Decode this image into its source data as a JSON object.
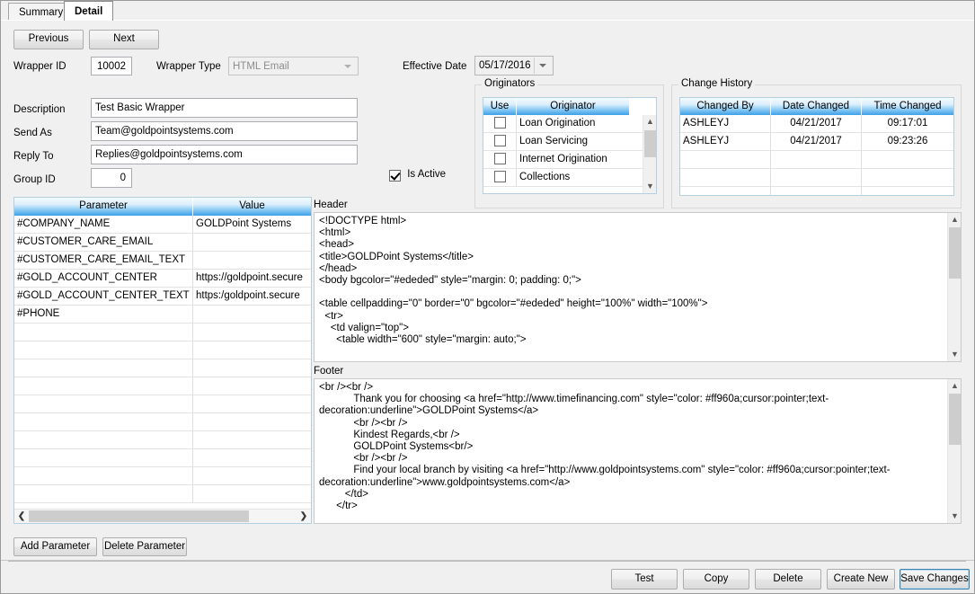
{
  "tabs": [
    {
      "label": "Summary",
      "active": false
    },
    {
      "label": "Detail",
      "active": true
    }
  ],
  "nav": {
    "previous_label": "Previous",
    "next_label": "Next"
  },
  "fields": {
    "wrapper_id_label": "Wrapper ID",
    "wrapper_id_value": "10002",
    "wrapper_type_label": "Wrapper Type",
    "wrapper_type_value": "HTML Email",
    "effective_date_label": "Effective Date",
    "effective_date_value": "05/17/2016",
    "description_label": "Description",
    "description_value": "Test Basic Wrapper",
    "send_as_label": "Send As",
    "send_as_value": "Team@goldpointsystems.com",
    "reply_to_label": "Reply To",
    "reply_to_value": "Replies@goldpointsystems.com",
    "group_id_label": "Group ID",
    "group_id_value": "0",
    "is_active_label": "Is Active",
    "is_active_checked": true
  },
  "originators": {
    "title": "Originators",
    "columns": [
      "Use",
      "Originator",
      ""
    ],
    "rows": [
      {
        "use": false,
        "name": "Loan Origination"
      },
      {
        "use": false,
        "name": "Loan Servicing"
      },
      {
        "use": false,
        "name": "Internet Origination"
      },
      {
        "use": false,
        "name": "Collections"
      }
    ]
  },
  "change_history": {
    "title": "Change History",
    "columns": [
      "Changed By",
      "Date Changed",
      "Time Changed"
    ],
    "rows": [
      {
        "changed_by": "ASHLEYJ",
        "date_changed": "04/21/2017",
        "time_changed": "09:17:01"
      },
      {
        "changed_by": "ASHLEYJ",
        "date_changed": "04/21/2017",
        "time_changed": "09:23:26"
      },
      {
        "changed_by": "",
        "date_changed": "",
        "time_changed": ""
      },
      {
        "changed_by": "",
        "date_changed": "",
        "time_changed": ""
      },
      {
        "changed_by": "",
        "date_changed": "",
        "time_changed": ""
      }
    ]
  },
  "parameters": {
    "columns": [
      "Parameter",
      "Value"
    ],
    "rows": [
      {
        "parameter": "#COMPANY_NAME",
        "value": "GOLDPoint Systems"
      },
      {
        "parameter": "#CUSTOMER_CARE_EMAIL",
        "value": ""
      },
      {
        "parameter": "#CUSTOMER_CARE_EMAIL_TEXT",
        "value": ""
      },
      {
        "parameter": "#GOLD_ACCOUNT_CENTER",
        "value": "https://goldpoint.secure"
      },
      {
        "parameter": "#GOLD_ACCOUNT_CENTER_TEXT",
        "value": "https:/goldpoint.secure"
      },
      {
        "parameter": "#PHONE",
        "value": ""
      },
      {
        "parameter": "",
        "value": ""
      },
      {
        "parameter": "",
        "value": ""
      },
      {
        "parameter": "",
        "value": ""
      },
      {
        "parameter": "",
        "value": ""
      },
      {
        "parameter": "",
        "value": ""
      },
      {
        "parameter": "",
        "value": ""
      },
      {
        "parameter": "",
        "value": ""
      },
      {
        "parameter": "",
        "value": ""
      },
      {
        "parameter": "",
        "value": ""
      },
      {
        "parameter": "",
        "value": ""
      }
    ],
    "add_label": "Add Parameter",
    "delete_label": "Delete Parameter"
  },
  "header_section": {
    "label": "Header",
    "text": "<!DOCTYPE html>\n<html>\n<head>\n<title>GOLDPoint Systems</title>\n</head>\n<body bgcolor=\"#ededed\" style=\"margin: 0; padding: 0;\">\n\n<table cellpadding=\"0\" border=\"0\" bgcolor=\"#ededed\" height=\"100%\" width=\"100%\">\n  <tr>\n    <td valign=\"top\">\n      <table width=\"600\" style=\"margin: auto;\">"
  },
  "footer_section": {
    "label": "Footer",
    "text": "<br /><br />\n            Thank you for choosing <a href=\"http://www.timefinancing.com\" style=\"color: #ff960a;cursor:pointer;text-decoration:underline\">GOLDPoint Systems</a>\n            <br /><br />\n            Kindest Regards,<br />\n            GOLDPoint Systems<br/>\n            <br /><br />\n            Find your local branch by visiting <a href=\"http://www.goldpointsystems.com\" style=\"color: #ff960a;cursor:pointer;text-decoration:underline\">www.goldpointsystems.com</a>\n         </td>\n      </tr>"
  },
  "actions": {
    "test_label": "Test",
    "copy_label": "Copy",
    "delete_label": "Delete",
    "create_new_label": "Create New",
    "save_changes_label": "Save Changes"
  },
  "icons": {
    "chevron_down": "⌄",
    "arrow_up": "⌃",
    "arrow_down": "⌄",
    "arrow_left": "❮",
    "arrow_right": "❯"
  }
}
